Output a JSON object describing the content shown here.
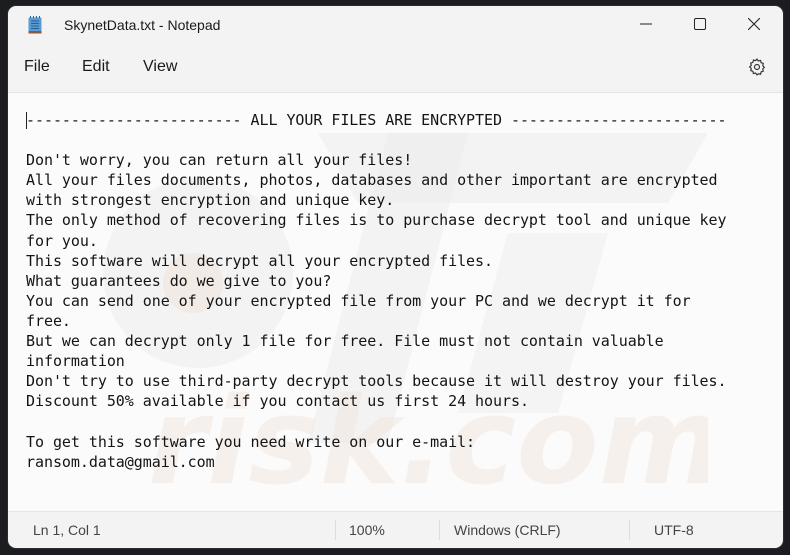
{
  "window": {
    "title": "SkynetData.txt - Notepad",
    "app_icon": "notepad-icon",
    "controls": [
      "minimize-icon",
      "maximize-icon",
      "close-icon"
    ]
  },
  "menu": {
    "items": [
      {
        "label": "File"
      },
      {
        "label": "Edit"
      },
      {
        "label": "View"
      }
    ],
    "settings_icon": "gear-icon"
  },
  "editor": {
    "content": "------------------------ ALL YOUR FILES ARE ENCRYPTED ------------------------\n\nDon't worry, you can return all your files!\nAll your files documents, photos, databases and other important are encrypted\nwith strongest encryption and unique key.\nThe only method of recovering files is to purchase decrypt tool and unique key\nfor you.\nThis software will decrypt all your encrypted files.\nWhat guarantees do we give to you?\nYou can send one of your encrypted file from your PC and we decrypt it for\nfree.\nBut we can decrypt only 1 file for free. File must not contain valuable\ninformation\nDon't try to use third-party decrypt tools because it will destroy your files.\nDiscount 50% available if you contact us first 24 hours.\n\nTo get this software you need write on our e-mail:\nransom.data@gmail.com"
  },
  "statusbar": {
    "position": "Ln 1, Col 1",
    "zoom": "100%",
    "line_ending": "Windows (CRLF)",
    "encoding": "UTF-8"
  }
}
